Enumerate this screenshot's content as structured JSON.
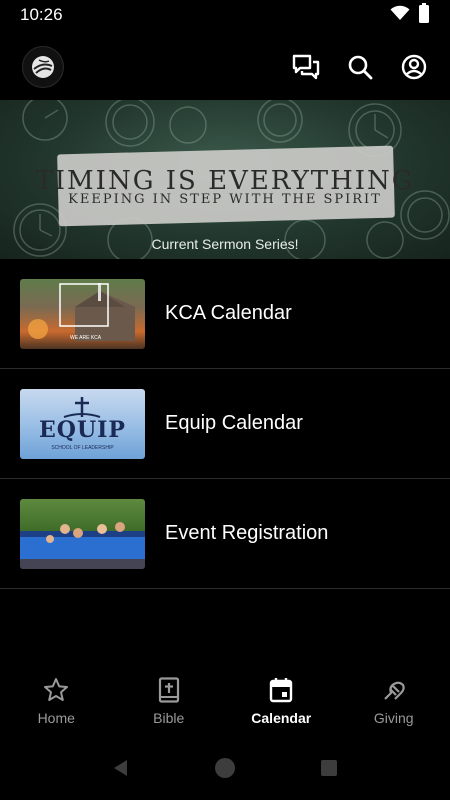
{
  "status_bar": {
    "time": "10:26",
    "icons": [
      "wifi-icon",
      "battery-icon"
    ]
  },
  "header": {
    "logo": "church-logo",
    "actions": [
      "chat-icon",
      "search-icon",
      "account-icon"
    ]
  },
  "banner": {
    "title": "TIMING IS EVERYTHING",
    "subtitle": "KEEPING IN STEP WITH THE SPIRIT",
    "caption": "Current Sermon Series!"
  },
  "list": {
    "items": [
      {
        "label": "KCA Calendar",
        "thumb_text": "WE ARE KCA"
      },
      {
        "label": "Equip Calendar",
        "thumb_text": "EQUIP",
        "thumb_subtext": "SCHOOL OF LEADERSHIP"
      },
      {
        "label": "Event Registration"
      }
    ]
  },
  "bottom_nav": {
    "items": [
      {
        "label": "Home",
        "icon": "star-icon"
      },
      {
        "label": "Bible",
        "icon": "bible-icon"
      },
      {
        "label": "Calendar",
        "icon": "calendar-icon",
        "active": true
      },
      {
        "label": "Giving",
        "icon": "giving-icon"
      }
    ]
  },
  "colors": {
    "background": "#000000",
    "text": "#ffffff",
    "inactive": "#9a9a9a",
    "divider": "#2c2c2c",
    "banner_green": "#2f4a3c"
  }
}
